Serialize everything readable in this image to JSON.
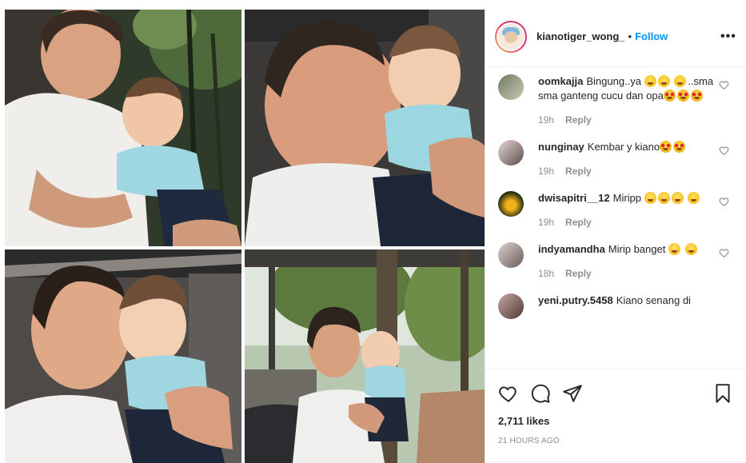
{
  "post": {
    "username": "kianotiger_wong_",
    "separator": "•",
    "follow_label": "Follow",
    "more_icon": "more-horizontal-icon"
  },
  "comments": [
    {
      "username": "oomkajja",
      "text": "Bingung..ya",
      "text2": "..sma sma ganteng cucu dan opa",
      "time": "19h",
      "reply_label": "Reply"
    },
    {
      "username": "nunginay",
      "text": "Kembar y kiano",
      "time": "19h",
      "reply_label": "Reply"
    },
    {
      "username": "dwisapitri__12",
      "text": "Miripp",
      "time": "19h",
      "reply_label": "Reply"
    },
    {
      "username": "indyamandha",
      "text": "Mirip banget",
      "time": "18h",
      "reply_label": "Reply"
    },
    {
      "username": "yeni.putry.5458",
      "text": "Kiano senang di"
    }
  ],
  "actions": {
    "like_icon": "heart-icon",
    "comment_icon": "comment-icon",
    "share_icon": "share-icon",
    "save_icon": "bookmark-icon"
  },
  "likes": "2,711 likes",
  "timestamp": "21 HOURS AGO",
  "colors": {
    "follow": "#0095f6",
    "secondary_text": "#8e8e8e",
    "divider": "#efefef"
  }
}
